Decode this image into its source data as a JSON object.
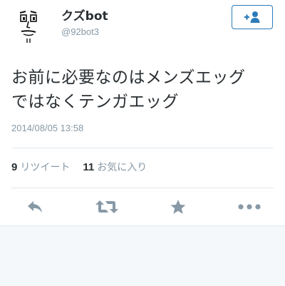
{
  "tweet": {
    "user": {
      "name": "クズbot",
      "handle": "@92bot3"
    },
    "text_lines": [
      "お前に必要なのはメンズエッグ",
      "ではなくテンガエッグ"
    ],
    "timestamp": "2014/08/05 13:58",
    "stats": {
      "retweets_count": "9",
      "retweets_label": "リツイート",
      "favorites_count": "11",
      "favorites_label": "お気に入り"
    }
  },
  "icons": {
    "follow": "add-user-icon",
    "reply": "reply-icon",
    "retweet": "retweet-icon",
    "favorite": "star-icon",
    "more": "more-icon"
  },
  "colors": {
    "accent": "#2b7bb9",
    "action_icon": "#8899a6",
    "text": "#292f33",
    "muted": "#8899a6"
  }
}
